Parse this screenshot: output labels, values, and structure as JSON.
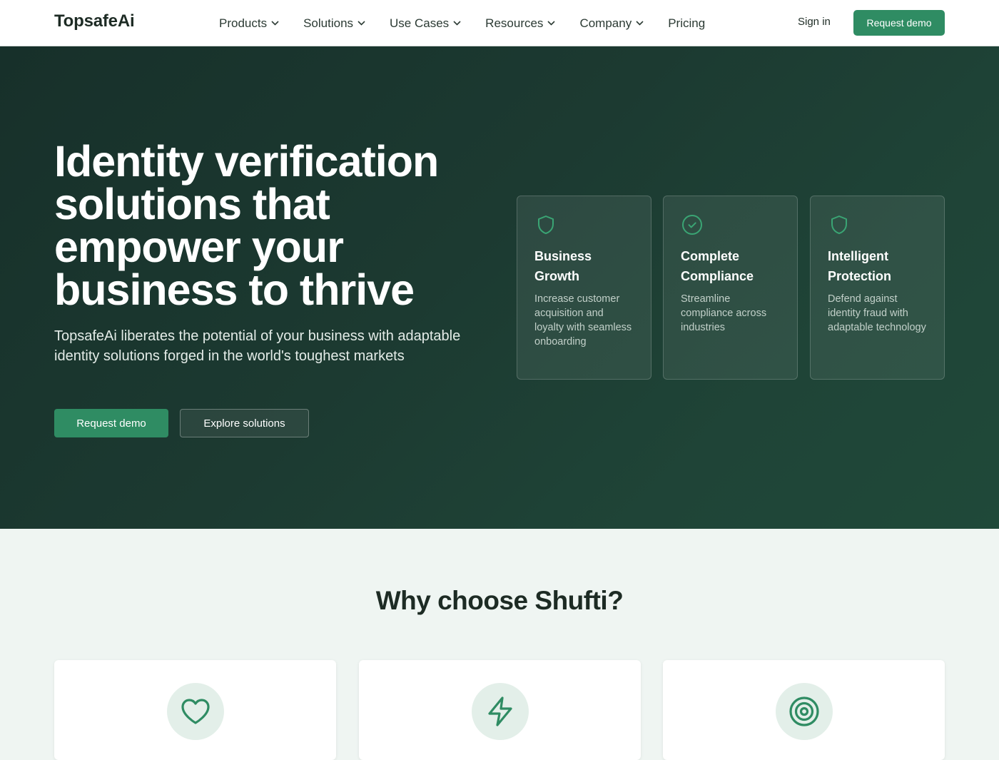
{
  "nav": {
    "logo": "TopsafeAi",
    "menu": [
      {
        "label": "Products",
        "has_dropdown": true
      },
      {
        "label": "Solutions",
        "has_dropdown": true
      },
      {
        "label": "Use Cases",
        "has_dropdown": true
      },
      {
        "label": "Resources",
        "has_dropdown": true
      },
      {
        "label": "Company",
        "has_dropdown": true
      },
      {
        "label": "Pricing",
        "has_dropdown": false
      }
    ],
    "sign_in": "Sign in",
    "cta": "Request demo"
  },
  "hero": {
    "title": "Identity verification solutions that empower your business to thrive",
    "subtitle": "TopsafeAi liberates the potential of your business with adaptable identity solutions forged in the world's toughest markets",
    "primary_button": "Request demo",
    "secondary_button": "Explore solutions",
    "cards": [
      {
        "icon": "shield-icon",
        "title": "Business Growth",
        "description": "Increase customer acquisition and loyalty with seamless onboarding"
      },
      {
        "icon": "check-circle-icon",
        "title": "Complete Compliance",
        "description": "Streamline compliance across industries"
      },
      {
        "icon": "shield-icon",
        "title": "Intelligent Protection",
        "description": "Defend against identity fraud with adaptable technology"
      }
    ]
  },
  "why": {
    "title": "Why choose Shufti?",
    "cards": [
      {
        "icon": "heart-icon"
      },
      {
        "icon": "lightning-icon"
      },
      {
        "icon": "target-icon"
      }
    ]
  },
  "colors": {
    "brand_green": "#2f8c63",
    "hero_bg": "#1c3a31",
    "section_bg": "#eff5f2"
  }
}
